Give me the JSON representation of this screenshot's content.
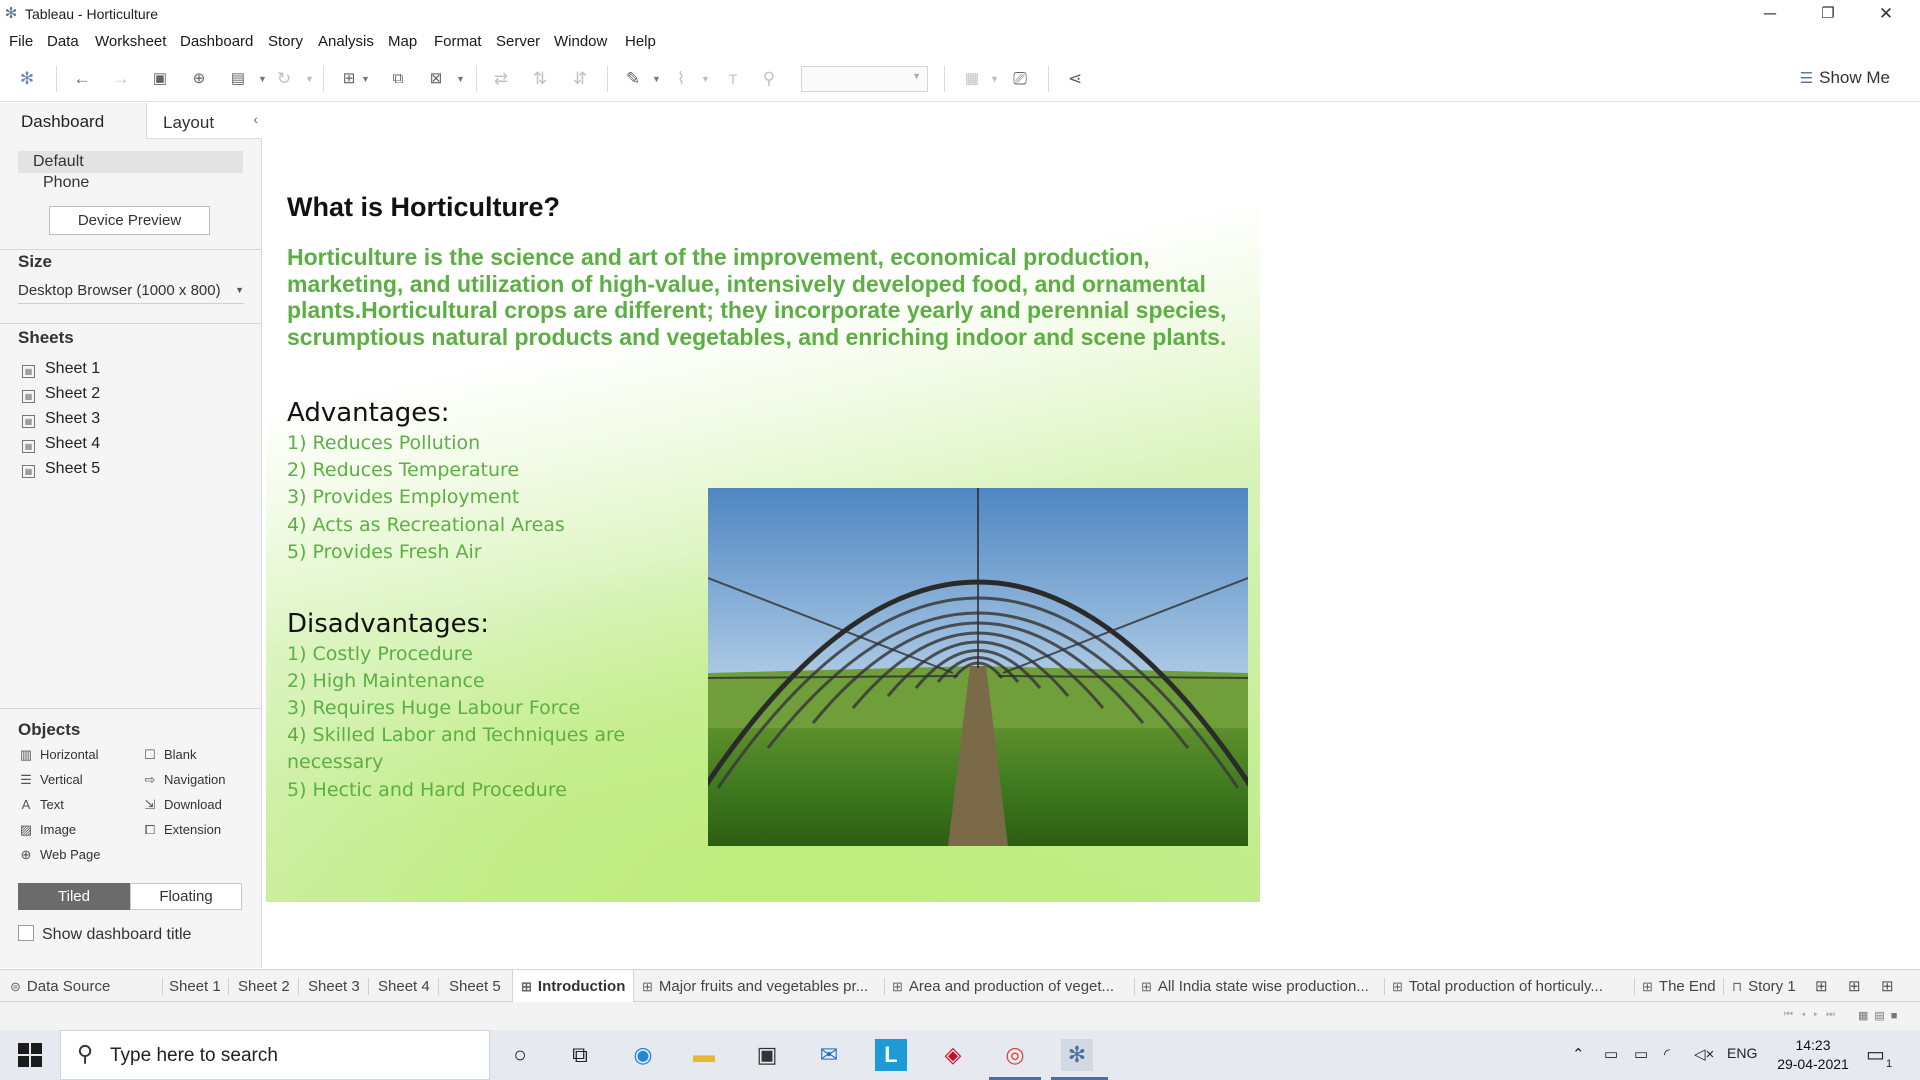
{
  "window": {
    "title": "Tableau - Horticulture"
  },
  "menu": [
    "File",
    "Data",
    "Worksheet",
    "Dashboard",
    "Story",
    "Analysis",
    "Map",
    "Format",
    "Server",
    "Window",
    "Help"
  ],
  "toolbar": {
    "show_me_label": "Show Me"
  },
  "left_panel": {
    "tabs": {
      "dashboard": "Dashboard",
      "layout": "Layout"
    },
    "devices": {
      "default": "Default",
      "phone": "Phone",
      "preview_button": "Device Preview"
    },
    "size": {
      "heading": "Size",
      "value": "Desktop Browser (1000 x 800)"
    },
    "sheets": {
      "heading": "Sheets",
      "items": [
        "Sheet 1",
        "Sheet 2",
        "Sheet 3",
        "Sheet 4",
        "Sheet 5"
      ]
    },
    "objects": {
      "heading": "Objects",
      "items": [
        "Horizontal",
        "Blank",
        "Vertical",
        "Navigation",
        "Text",
        "Download",
        "Image",
        "Extension",
        "Web Page"
      ]
    },
    "tiled_label": "Tiled",
    "floating_label": "Floating",
    "show_title_label": "Show dashboard title"
  },
  "dashboard": {
    "title": "What is Horticulture?",
    "definition": "Horticulture is the science and art of the improvement, economical production, marketing, and utilization of high-value, intensively developed food, and ornamental plants.Horticultural crops are different; they incorporate yearly and perennial species, scrumptious natural products and vegetables, and enriching indoor and scene plants.",
    "advantages_heading": "Advantages:",
    "advantages": [
      "1) Reduces Pollution",
      "2) Reduces Temperature",
      "3) Provides Employment",
      "4) Acts as Recreational Areas",
      "5) Provides Fresh Air"
    ],
    "disadvantages_heading": "Disadvantages:",
    "disadvantages": [
      "1) Costly Procedure",
      "2) High Maintenance",
      "3) Requires Huge Labour Force",
      "4) Skilled Labor and Techniques are",
      "necessary",
      "5) Hectic and Hard Procedure"
    ]
  },
  "sheet_tabs": {
    "data_source": "Data Source",
    "tabs": [
      "Sheet 1",
      "Sheet 2",
      "Sheet 3",
      "Sheet 4",
      "Sheet 5",
      "Introduction",
      "Major fruits and vegetables pr...",
      "Area and production of veget...",
      "All India state wise production...",
      "Total production of horticuly...",
      "The End",
      "Story 1"
    ],
    "active": "Introduction"
  },
  "taskbar": {
    "search_placeholder": "Type here to search",
    "language": "ENG",
    "time": "14:23",
    "date": "29-04-2021",
    "notification_count": "1"
  },
  "colors": {
    "accent_green": "#5caf43",
    "tab_active_bg": "#ffffff",
    "tiled_bg": "#6b6b6b"
  }
}
